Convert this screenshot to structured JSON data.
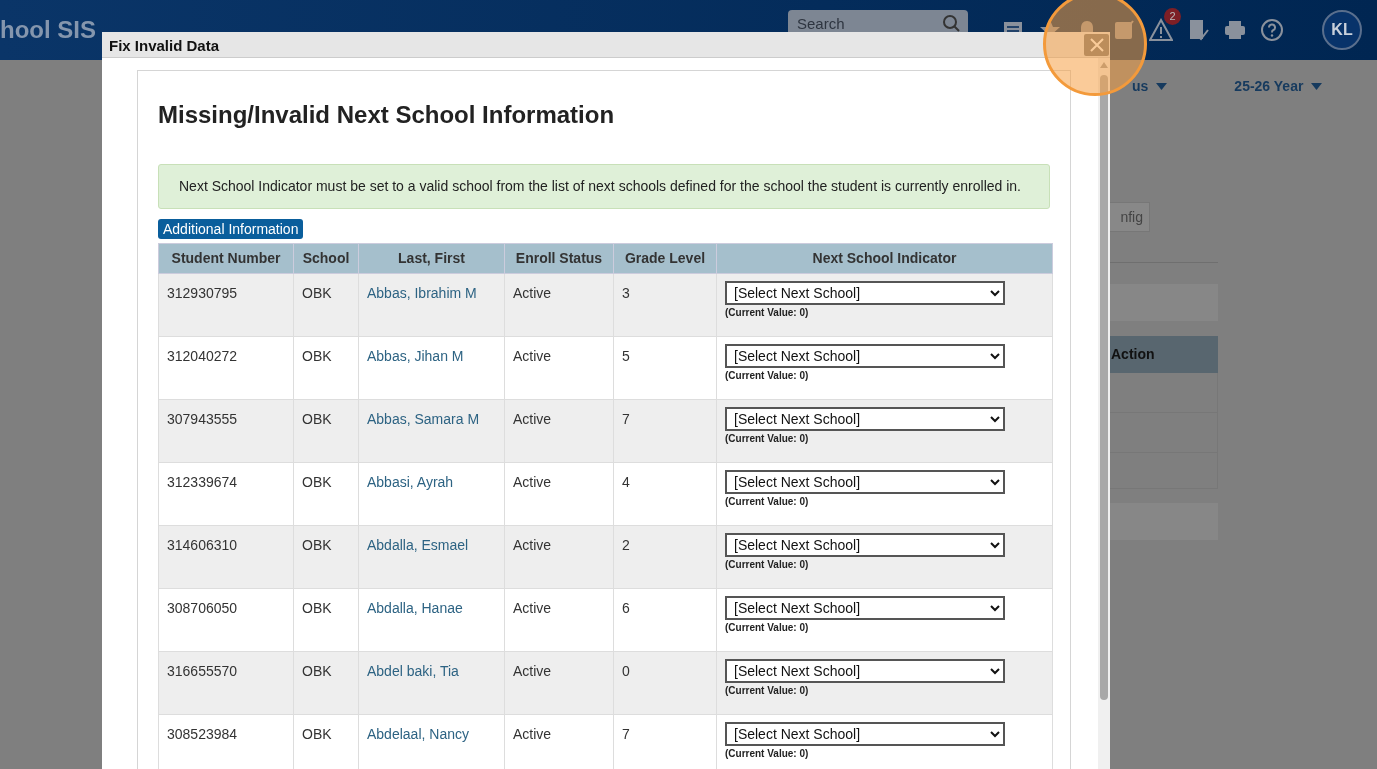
{
  "app_header": {
    "brand": "hool SIS",
    "search": {
      "placeholder": "Search"
    },
    "alert_badge": "2",
    "avatar": "KL"
  },
  "background_page": {
    "filters": [
      "us",
      "25-26 Year"
    ],
    "tab": "nfig",
    "table_column": "Action"
  },
  "dialog": {
    "title": "Fix Invalid Data",
    "heading": "Missing/Invalid Next School Information",
    "alert": "Next School Indicator must be set to a valid school from the list of next schools defined for the school the student is currently enrolled in.",
    "info_button": "Additional Information",
    "columns": [
      "Student Number",
      "School",
      "Last, First",
      "Enroll Status",
      "Grade Level",
      "Next School Indicator"
    ],
    "rows": [
      {
        "student_number": "312930795",
        "school": "OBK",
        "name": "Abbas, Ibrahim M",
        "enroll_status": "Active",
        "grade_level": "3",
        "next_school": "[Select Next School]",
        "current_value": "(Current Value: 0)"
      },
      {
        "student_number": "312040272",
        "school": "OBK",
        "name": "Abbas, Jihan M",
        "enroll_status": "Active",
        "grade_level": "5",
        "next_school": "[Select Next School]",
        "current_value": "(Current Value: 0)"
      },
      {
        "student_number": "307943555",
        "school": "OBK",
        "name": "Abbas, Samara M",
        "enroll_status": "Active",
        "grade_level": "7",
        "next_school": "[Select Next School]",
        "current_value": "(Current Value: 0)"
      },
      {
        "student_number": "312339674",
        "school": "OBK",
        "name": "Abbasi, Ayrah",
        "enroll_status": "Active",
        "grade_level": "4",
        "next_school": "[Select Next School]",
        "current_value": "(Current Value: 0)"
      },
      {
        "student_number": "314606310",
        "school": "OBK",
        "name": "Abdalla, Esmael",
        "enroll_status": "Active",
        "grade_level": "2",
        "next_school": "[Select Next School]",
        "current_value": "(Current Value: 0)"
      },
      {
        "student_number": "308706050",
        "school": "OBK",
        "name": "Abdalla, Hanae",
        "enroll_status": "Active",
        "grade_level": "6",
        "next_school": "[Select Next School]",
        "current_value": "(Current Value: 0)"
      },
      {
        "student_number": "316655570",
        "school": "OBK",
        "name": "Abdel baki, Tia",
        "enroll_status": "Active",
        "grade_level": "0",
        "next_school": "[Select Next School]",
        "current_value": "(Current Value: 0)"
      },
      {
        "student_number": "308523984",
        "school": "OBK",
        "name": "Abdelaal, Nancy",
        "enroll_status": "Active",
        "grade_level": "7",
        "next_school": "[Select Next School]",
        "current_value": "(Current Value: 0)"
      }
    ]
  }
}
